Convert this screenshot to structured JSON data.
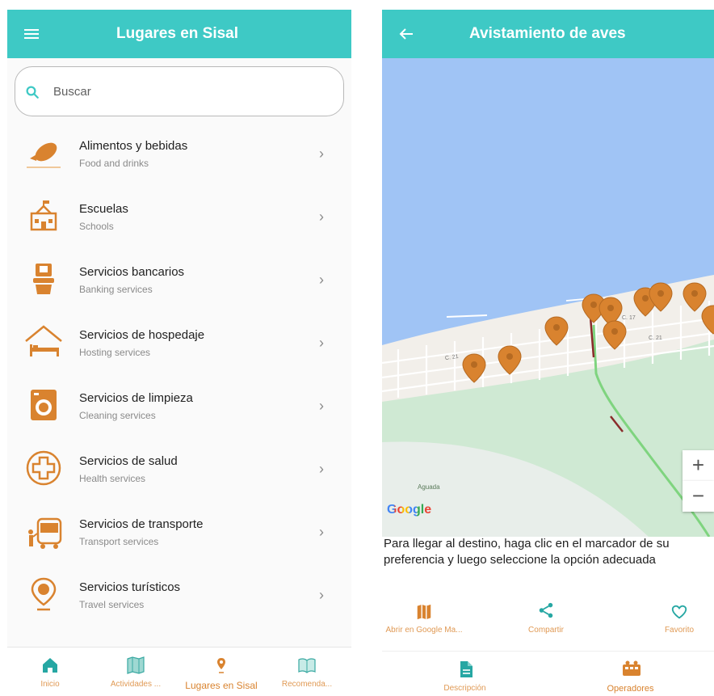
{
  "colors": {
    "accent": "#3ec9c5",
    "icon_orange": "#d9832f",
    "active_nav": "#26a7a3"
  },
  "left_screen": {
    "appbar": {
      "title": "Lugares en Sisal",
      "menu_icon": "hamburger-icon"
    },
    "search": {
      "placeholder": "Buscar",
      "icon": "search-icon"
    },
    "categories": [
      {
        "title": "Alimentos y bebidas",
        "subtitle": "Food and drinks",
        "icon": "food-icon"
      },
      {
        "title": "Escuelas",
        "subtitle": "Schools",
        "icon": "school-icon"
      },
      {
        "title": "Servicios bancarios",
        "subtitle": "Banking services",
        "icon": "atm-icon"
      },
      {
        "title": "Servicios de hospedaje",
        "subtitle": "Hosting services",
        "icon": "bed-icon"
      },
      {
        "title": "Servicios de limpieza",
        "subtitle": "Cleaning services",
        "icon": "washing-machine-icon"
      },
      {
        "title": "Servicios de salud",
        "subtitle": "Health services",
        "icon": "health-cross-icon"
      },
      {
        "title": "Servicios de transporte",
        "subtitle": "Transport services",
        "icon": "bus-icon"
      },
      {
        "title": "Servicios turísticos",
        "subtitle": "Travel services",
        "icon": "tourism-pin-icon"
      }
    ],
    "bottom_nav": [
      {
        "label": "Inicio",
        "icon": "home-icon",
        "active": false
      },
      {
        "label": "Actividades ...",
        "icon": "map-icon",
        "active": false
      },
      {
        "label": "Lugares en Sisal",
        "icon": "location-pin-icon",
        "active": true
      },
      {
        "label": "Recomenda...",
        "icon": "book-icon",
        "active": false
      }
    ]
  },
  "right_screen": {
    "appbar": {
      "title": "Avistamiento de aves",
      "back_icon": "arrow-left-icon"
    },
    "map": {
      "google_label": "Google",
      "place_label": "Aguada",
      "zoom_in": "+",
      "zoom_out": "−",
      "street_labels": [
        "C. 21",
        "C. 17",
        "C. 21"
      ]
    },
    "info_text": "Para llegar al destino, haga clic en el marcador de su preferencia y luego seleccione la opción adecuada",
    "actions": [
      {
        "label": "Abrir en Google Ma...",
        "icon": "map-icon"
      },
      {
        "label": "Compartir",
        "icon": "share-icon"
      },
      {
        "label": "Favorito",
        "icon": "heart-icon"
      }
    ],
    "bottom_nav": [
      {
        "label": "Descripción",
        "icon": "document-icon",
        "active": false
      },
      {
        "label": "Operadores",
        "icon": "operators-icon",
        "active": true
      }
    ]
  }
}
